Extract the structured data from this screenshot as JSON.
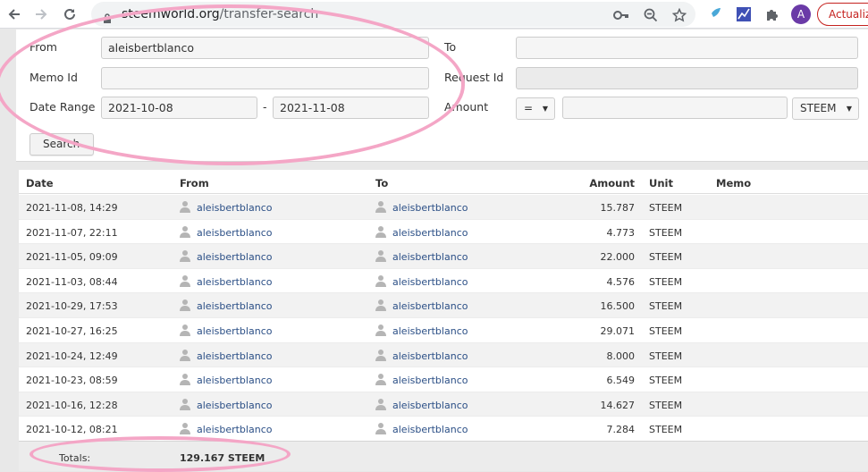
{
  "browser": {
    "url_host": "steemworld.org",
    "url_path": "/transfer-search",
    "profile_initial": "A",
    "update_label": "Actualiza"
  },
  "form": {
    "from_label": "From",
    "from_value": "aleisbertblanco",
    "to_label": "To",
    "to_value": "",
    "memo_id_label": "Memo Id",
    "memo_id_value": "",
    "request_id_label": "Request Id",
    "request_id_value": "",
    "date_range_label": "Date Range",
    "date_start": "2021-10-08",
    "date_separator": "-",
    "date_end": "2021-11-08",
    "amount_label": "Amount",
    "amount_operator": "=",
    "amount_value": "",
    "unit": "STEEM",
    "search_label": "Search"
  },
  "table": {
    "headers": {
      "date": "Date",
      "from": "From",
      "to": "To",
      "amount": "Amount",
      "unit": "Unit",
      "memo": "Memo"
    },
    "rows": [
      {
        "date": "2021-11-08, 14:29",
        "from": "aleisbertblanco",
        "to": "aleisbertblanco",
        "amount": "15.787",
        "unit": "STEEM",
        "memo": ""
      },
      {
        "date": "2021-11-07, 22:11",
        "from": "aleisbertblanco",
        "to": "aleisbertblanco",
        "amount": "4.773",
        "unit": "STEEM",
        "memo": ""
      },
      {
        "date": "2021-11-05, 09:09",
        "from": "aleisbertblanco",
        "to": "aleisbertblanco",
        "amount": "22.000",
        "unit": "STEEM",
        "memo": ""
      },
      {
        "date": "2021-11-03, 08:44",
        "from": "aleisbertblanco",
        "to": "aleisbertblanco",
        "amount": "4.576",
        "unit": "STEEM",
        "memo": ""
      },
      {
        "date": "2021-10-29, 17:53",
        "from": "aleisbertblanco",
        "to": "aleisbertblanco",
        "amount": "16.500",
        "unit": "STEEM",
        "memo": ""
      },
      {
        "date": "2021-10-27, 16:25",
        "from": "aleisbertblanco",
        "to": "aleisbertblanco",
        "amount": "29.071",
        "unit": "STEEM",
        "memo": ""
      },
      {
        "date": "2021-10-24, 12:49",
        "from": "aleisbertblanco",
        "to": "aleisbertblanco",
        "amount": "8.000",
        "unit": "STEEM",
        "memo": ""
      },
      {
        "date": "2021-10-23, 08:59",
        "from": "aleisbertblanco",
        "to": "aleisbertblanco",
        "amount": "6.549",
        "unit": "STEEM",
        "memo": ""
      },
      {
        "date": "2021-10-16, 12:28",
        "from": "aleisbertblanco",
        "to": "aleisbertblanco",
        "amount": "14.627",
        "unit": "STEEM",
        "memo": ""
      },
      {
        "date": "2021-10-12, 08:21",
        "from": "aleisbertblanco",
        "to": "aleisbertblanco",
        "amount": "7.284",
        "unit": "STEEM",
        "memo": ""
      }
    ],
    "totals_label": "Totals:",
    "totals_value": "129.167 STEEM"
  },
  "icons": {
    "back": "back-arrow-icon",
    "forward": "forward-arrow-icon",
    "reload": "reload-icon",
    "lock": "lock-icon",
    "key": "key-icon",
    "zoom": "zoom-out-icon",
    "star": "star-icon",
    "user": "user-icon"
  },
  "colors": {
    "annotation": "#f4a6c6",
    "link": "#2b4f86",
    "update_red": "#c5221f",
    "avatar": "#6a3aa7"
  }
}
